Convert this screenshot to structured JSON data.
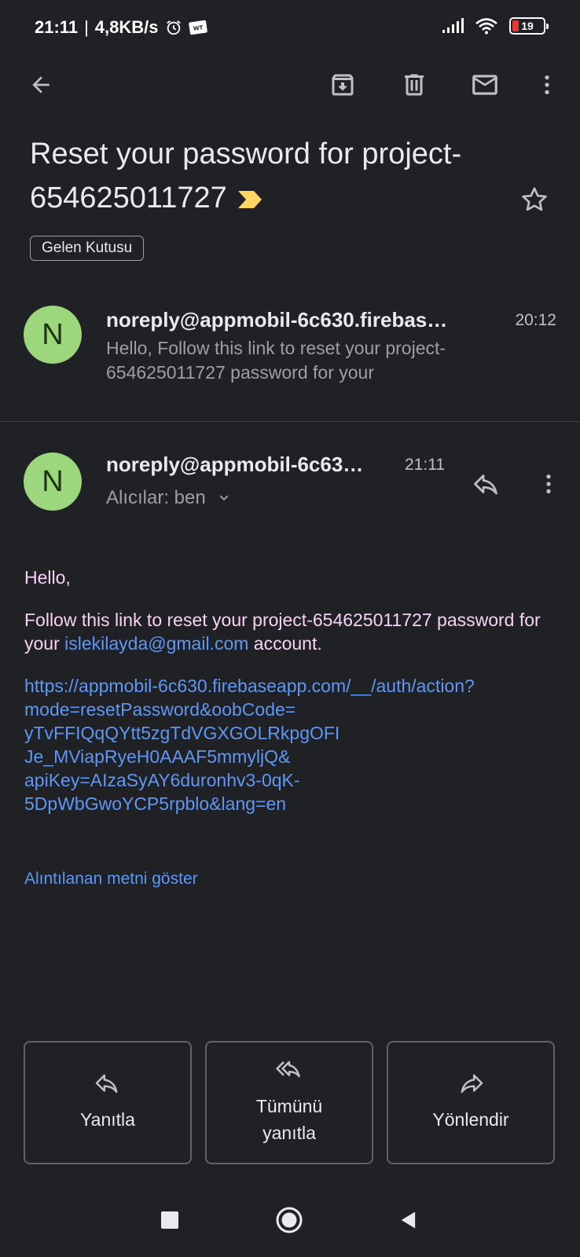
{
  "status_bar": {
    "time": "21:11",
    "separator": "|",
    "net_speed": "4,8KB/s",
    "battery_level": "19",
    "icons": [
      "alarm-icon",
      "webtoon-icon",
      "signal-icon",
      "wifi-icon",
      "battery-icon"
    ]
  },
  "toolbar": {
    "icons": [
      "back-arrow-icon",
      "archive-icon",
      "delete-icon",
      "mark-unread-icon",
      "more-vert-icon"
    ]
  },
  "email": {
    "subject": "Reset your password for project-654625011727",
    "label": "Gelen Kutusu",
    "important_color": "#fdd663"
  },
  "message1": {
    "avatar_letter": "N",
    "sender": "noreply@appmobil-6c630.firebas…",
    "time": "20:12",
    "snippet": "Hello, Follow this link to reset your project-654625011727 password for your"
  },
  "message2": {
    "avatar_letter": "N",
    "sender": "noreply@appmobil-6c63…",
    "time": "21:11",
    "recipients": "Alıcılar: ben",
    "body": {
      "greeting": "Hello,",
      "line_pre": "Follow this link to reset your project-654625011727 password for your",
      "email_link": "islekilayda@gmail.com",
      "line_post": "account.",
      "reset_link": "https://appmobil-6c630.firebaseapp.com/__/auth/action?mode=resetPassword&oobCode=yTvFFIQqQYtt5zgTdVGXGOLRkpgOFIJe_MViapRyeH0AAAF5mmyljQ&apiKey=AIzaSyAY6duronhv3-0qK-5DpWbGwoYCP5rpblo&lang=en"
    },
    "show_quoted": "Alıntılanan metni göster"
  },
  "actions": {
    "reply": "Yanıtla",
    "reply_all": "Tümünü yanıtla",
    "forward": "Yönlendir"
  },
  "colors": {
    "background": "#202124",
    "avatar": "#9cd67d",
    "link": "#5e97f6",
    "body_text": "#f8d1f6"
  }
}
